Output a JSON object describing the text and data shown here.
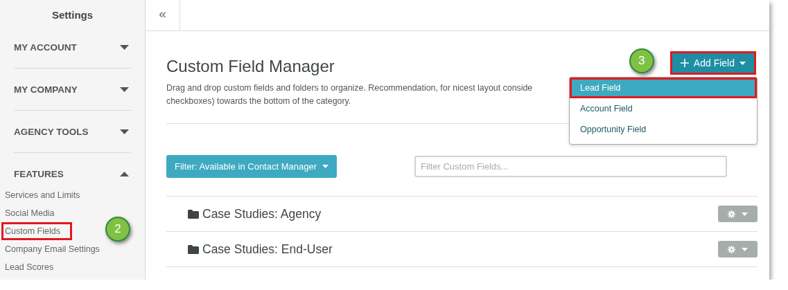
{
  "sidebar": {
    "title": "Settings",
    "sections": [
      {
        "label": "MY ACCOUNT",
        "expanded": false
      },
      {
        "label": "MY COMPANY",
        "expanded": false
      },
      {
        "label": "AGENCY TOOLS",
        "expanded": false
      },
      {
        "label": "FEATURES",
        "expanded": true,
        "items": [
          {
            "label": "Services and Limits",
            "highlighted": false
          },
          {
            "label": "Social Media",
            "highlighted": false
          },
          {
            "label": "Custom Fields",
            "highlighted": true,
            "callout": "2"
          },
          {
            "label": "Company Email Settings",
            "highlighted": false
          },
          {
            "label": "Lead Scores",
            "highlighted": false
          }
        ]
      }
    ]
  },
  "toolbar": {
    "collapse_button": "«"
  },
  "main": {
    "title": "Custom Field Manager",
    "description_lines": [
      "Drag and drop custom fields and folders to organize. Recommendation, for nicest layout conside",
      "checkboxes) towards the bottom of the category."
    ],
    "add_button": {
      "label": "Add Field",
      "highlighted": true,
      "callout": "3"
    },
    "add_menu": [
      {
        "label": "Lead Field",
        "selected": true,
        "highlighted": true
      },
      {
        "label": "Account Field",
        "selected": false,
        "highlighted": false
      },
      {
        "label": "Opportunity Field",
        "selected": false,
        "highlighted": false
      }
    ],
    "filter_button": "Filter: Available in Contact Manager",
    "search": {
      "placeholder": "Filter Custom Fields..."
    },
    "folders": [
      {
        "name": "Case Studies: Agency"
      },
      {
        "name": "Case Studies: End-User"
      }
    ]
  }
}
